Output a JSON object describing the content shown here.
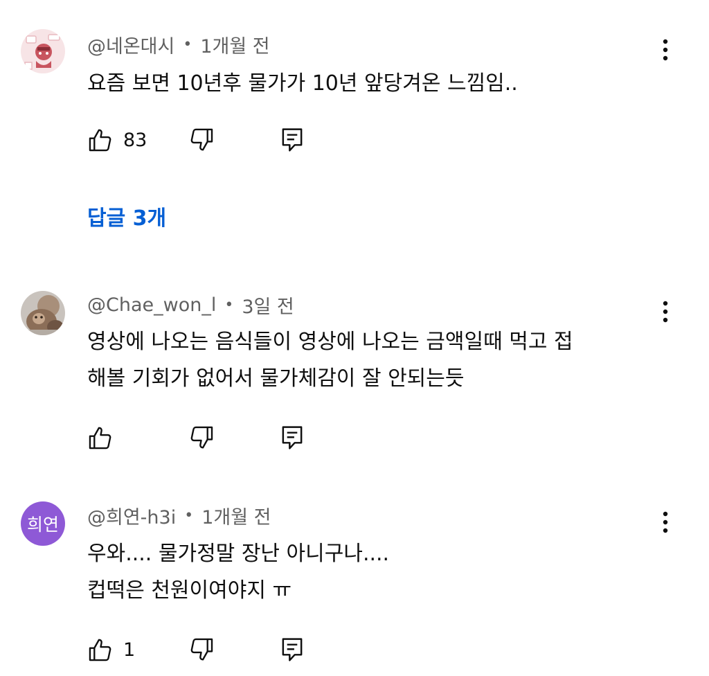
{
  "comments": [
    {
      "author": "@네온대시",
      "time": "1개월 전",
      "lines": [
        "요즘 보면 10년후 물가가 10년 앞당겨온 느낌임.."
      ],
      "like_count": "83",
      "replies_label": "답글 3개"
    },
    {
      "author": "@Chae_won_l",
      "time": "3일 전",
      "lines": [
        "영상에 나오는 음식들이 영상에 나오는 금액일때 먹고 접",
        "해볼 기회가 없어서 물가체감이 잘 안되는듯"
      ],
      "like_count": ""
    },
    {
      "author": "@희연-h3i",
      "avatar_text": "희연",
      "time": "1개월 전",
      "lines": [
        "우와.... 물가정말 장난 아니구나....",
        "컵떡은 천원이여야지 ㅠ"
      ],
      "like_count": "1"
    }
  ],
  "separator": "•",
  "colors": {
    "text": "#0f0f0f",
    "meta": "#606060",
    "link": "#065fd4",
    "avatar_purple": "#8e59d6"
  },
  "icons": [
    "thumbs-up-icon",
    "thumbs-down-icon",
    "reply-icon",
    "more-vert-icon"
  ]
}
